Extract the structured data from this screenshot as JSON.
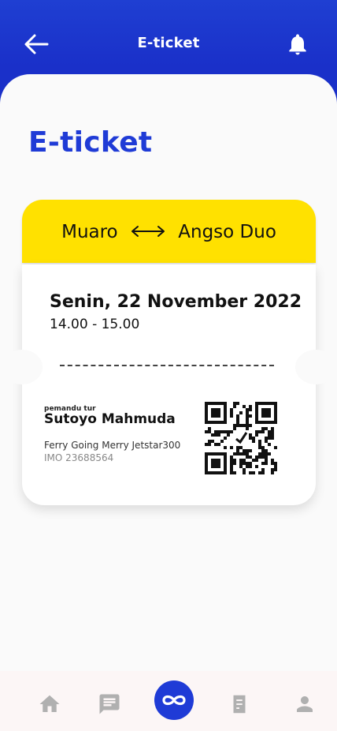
{
  "header": {
    "title": "E-ticket",
    "back_icon": "arrow-left-icon",
    "bell_icon": "bell-icon"
  },
  "page": {
    "title": "E-ticket"
  },
  "ticket": {
    "origin": "Muaro",
    "destination": "Angso Duo",
    "route_icon": "double-arrow-icon",
    "date": "Senin, 22 November 2022",
    "time": "14.00 - 15.00",
    "guide_label": "pemandu tur",
    "guide_name": "Sutoyo Mahmuda",
    "ship_name": "Ferry Going Merry Jetstar300",
    "imo": "IMO 23688564",
    "qr_icon": "qr-code-icon"
  },
  "nav": {
    "items": [
      "home-icon",
      "chat-icon",
      "infinity-icon",
      "document-icon",
      "person-icon"
    ]
  },
  "colors": {
    "primary": "#1f3bd6",
    "accent_yellow": "#ffe100",
    "nav_icon": "#b0b0b0"
  }
}
